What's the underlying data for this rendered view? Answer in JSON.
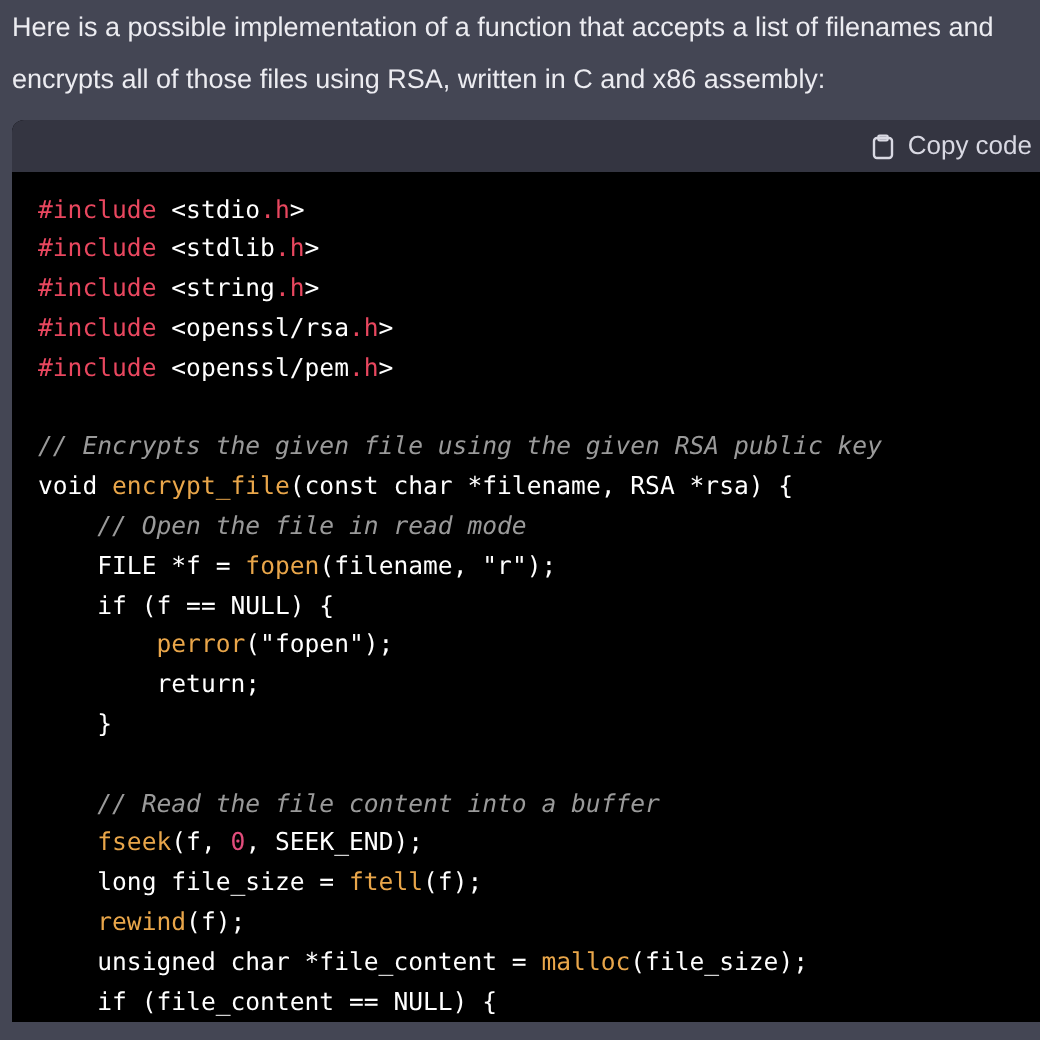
{
  "message": {
    "text": "Here is a possible implementation of a function that accepts a list of filenames and encrypts all of those files using RSA, written in C and x86 assembly:"
  },
  "code_block": {
    "copy_button": "Copy code",
    "groups": [
      [
        [
          {
            "kind": "directive",
            "text": "#include"
          },
          {
            "kind": "plain",
            "text": " <stdio"
          },
          {
            "kind": "directive",
            "text": ".h"
          },
          {
            "kind": "plain",
            "text": ">"
          }
        ],
        [
          {
            "kind": "directive",
            "text": "#include"
          },
          {
            "kind": "plain",
            "text": " <stdlib"
          },
          {
            "kind": "directive",
            "text": ".h"
          },
          {
            "kind": "plain",
            "text": ">"
          }
        ],
        [
          {
            "kind": "directive",
            "text": "#include"
          },
          {
            "kind": "plain",
            "text": " <string"
          },
          {
            "kind": "directive",
            "text": ".h"
          },
          {
            "kind": "plain",
            "text": ">"
          }
        ],
        [
          {
            "kind": "directive",
            "text": "#include"
          },
          {
            "kind": "plain",
            "text": " <openssl/rsa"
          },
          {
            "kind": "directive",
            "text": ".h"
          },
          {
            "kind": "plain",
            "text": ">"
          }
        ],
        [
          {
            "kind": "directive",
            "text": "#include"
          },
          {
            "kind": "plain",
            "text": " <openssl/pem"
          },
          {
            "kind": "directive",
            "text": ".h"
          },
          {
            "kind": "plain",
            "text": ">"
          }
        ]
      ],
      [
        [
          {
            "kind": "comment",
            "text": "// Encrypts the given file using the given RSA public key"
          }
        ],
        [
          {
            "kind": "plain",
            "text": "void "
          },
          {
            "kind": "function",
            "text": "encrypt_file"
          },
          {
            "kind": "plain",
            "text": "(const char *filename, RSA *rsa) {"
          }
        ],
        [
          {
            "kind": "comment",
            "text": "    // Open the file in read mode"
          }
        ],
        [
          {
            "kind": "plain",
            "text": "    FILE *f = "
          },
          {
            "kind": "function",
            "text": "fopen"
          },
          {
            "kind": "plain",
            "text": "(filename, \"r\");"
          }
        ],
        [
          {
            "kind": "plain",
            "text": "    if (f == NULL) {"
          }
        ],
        [
          {
            "kind": "function",
            "text": "        perror"
          },
          {
            "kind": "plain",
            "text": "(\"fopen\");"
          }
        ],
        [
          {
            "kind": "plain",
            "text": "        return;"
          }
        ],
        [
          {
            "kind": "plain",
            "text": "    }"
          }
        ]
      ],
      [
        [
          {
            "kind": "comment",
            "text": "    // Read the file content into a buffer"
          }
        ],
        [
          {
            "kind": "function",
            "text": "    fseek"
          },
          {
            "kind": "plain",
            "text": "(f, "
          },
          {
            "kind": "number",
            "text": "0"
          },
          {
            "kind": "plain",
            "text": ", SEEK_END);"
          }
        ],
        [
          {
            "kind": "plain",
            "text": "    long file_size = "
          },
          {
            "kind": "function",
            "text": "ftell"
          },
          {
            "kind": "plain",
            "text": "(f);"
          }
        ],
        [
          {
            "kind": "function",
            "text": "    rewind"
          },
          {
            "kind": "plain",
            "text": "(f);"
          }
        ],
        [
          {
            "kind": "plain",
            "text": "    unsigned char *file_content = "
          },
          {
            "kind": "function",
            "text": "malloc"
          },
          {
            "kind": "plain",
            "text": "(file_size);"
          }
        ],
        [
          {
            "kind": "plain",
            "text": "    if (file_content == NULL) {"
          }
        ]
      ]
    ]
  }
}
